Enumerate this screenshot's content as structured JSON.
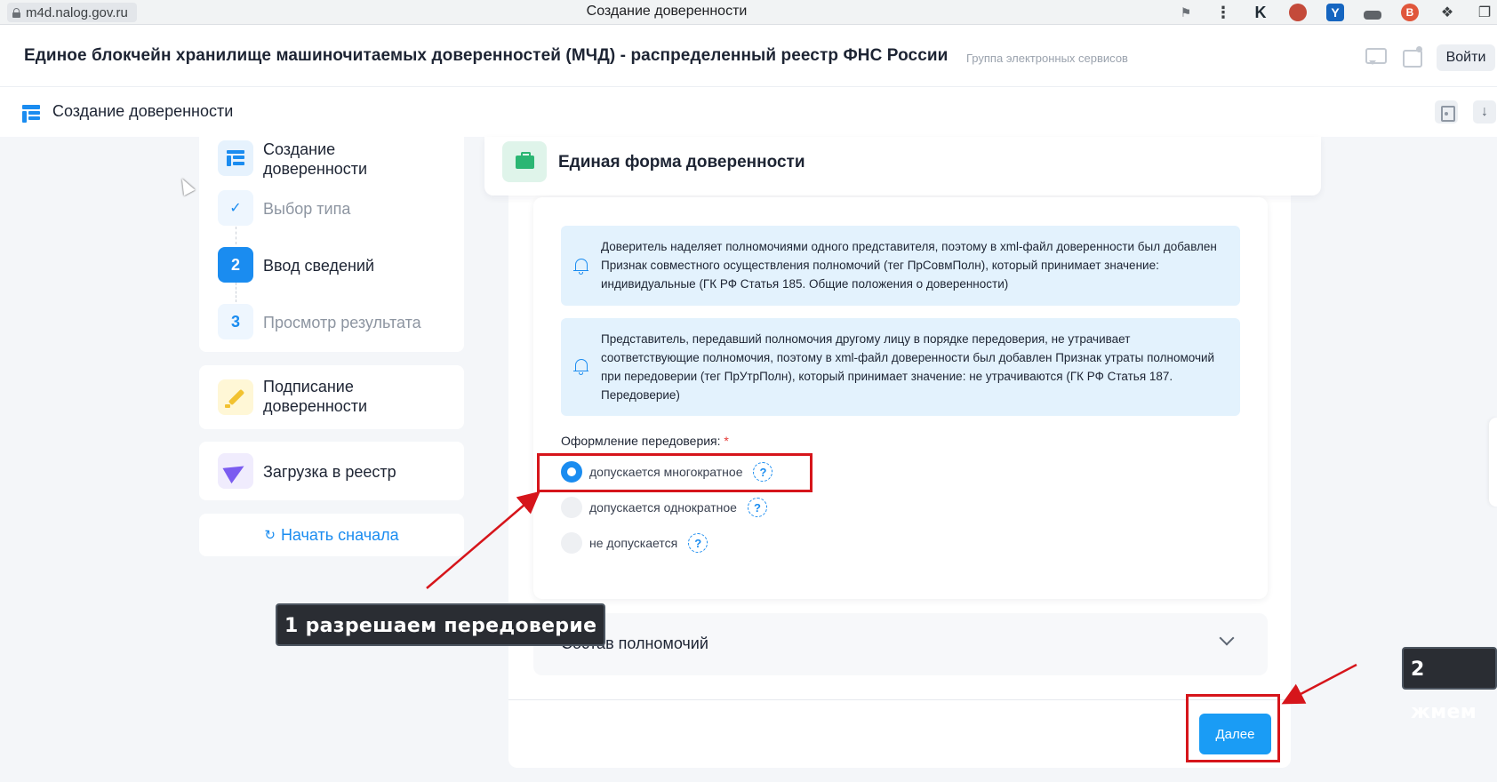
{
  "browser": {
    "url": "m4d.nalog.gov.ru",
    "tab_title": "Создание доверенности",
    "extensions": [
      "bookmark-icon",
      "menu-dots-icon",
      "kaspersky-icon",
      "stamp-icon",
      "yandex-icon",
      "browser-icon",
      "vpn-icon",
      "puzzle-icon",
      "copy-icon"
    ]
  },
  "header": {
    "title": "Единое блокчейн хранилище машиночитаемых доверенностей (МЧД) - распределенный реестр ФНС России",
    "subtitle": "Группа электронных сервисов",
    "login_label": "Войти"
  },
  "subheader": {
    "title": "Создание доверенности"
  },
  "sidebar": {
    "section_create": "Создание доверенности",
    "steps": [
      {
        "marker": "✓",
        "label": "Выбор типа",
        "state": "done"
      },
      {
        "marker": "2",
        "label": "Ввод сведений",
        "state": "active"
      },
      {
        "marker": "3",
        "label": "Просмотр результата",
        "state": "pending"
      }
    ],
    "section_sign": "Подписание доверенности",
    "section_upload": "Загрузка в реестр",
    "restart_label": "Начать сначала"
  },
  "form": {
    "title": "Единая форма доверенности",
    "info": [
      "Доверитель наделяет полномочиями одного представителя, поэтому в xml-файл доверенности был добавлен Признак совместного осуществления полномочий (тег ПрСовмПолн), который принимает значение: индивидуальные (ГК РФ Статья 185. Общие положения о доверенности)",
      "Представитель, передавший полномочия другому лицу в порядке передоверия, не утрачивает соответствующие полномочия, поэтому в xml-файл доверенности был добавлен Признак утраты полномочий при передоверии (тег ПрУтрПолн), который принимает значение: не утрачиваются (ГК РФ Статья 187. Передоверие)"
    ],
    "redelegation_label": "Оформление передоверия:",
    "required_mark": "*",
    "options": [
      {
        "label": "допускается многократное",
        "checked": true
      },
      {
        "label": "допускается однократное",
        "checked": false
      },
      {
        "label": "не допускается",
        "checked": false
      }
    ],
    "help_glyph": "?",
    "powers_section": "Состав полномочий",
    "next_label": "Далее"
  },
  "annotations": {
    "callout_1": "1 разрешаем передоверие",
    "callout_2": "2 жмем",
    "color": "#d6151b"
  },
  "colors": {
    "accent": "#1a8cf0",
    "info_bg": "#e3f2fd",
    "success": "#2bb673"
  }
}
